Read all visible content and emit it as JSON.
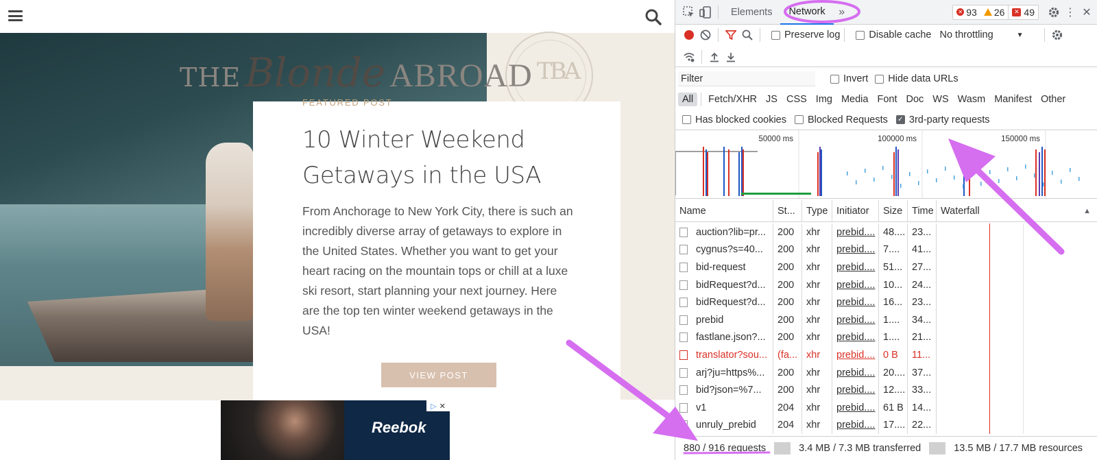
{
  "site": {
    "logo_the": "THE",
    "logo_blonde": "Blonde",
    "logo_abroad": "ABROAD",
    "stamp_mark": "TBA",
    "featured_label": "FEATURED POST",
    "post_title": "10 Winter Weekend Getaways in the USA",
    "post_excerpt": "From Anchorage to New York City, there is such an incredibly diverse array of getaways to explore in the United States. Whether you want to get your heart racing on the mountain tops or chill at a luxe ski resort, start planning your next journey. Here are the top ten winter weekend getaways in the USA!",
    "view_post_label": "VIEW POST",
    "ad_brand": "Reebok",
    "icons": {
      "menu": "hamburger-menu-icon",
      "search": "search-icon"
    }
  },
  "devtools": {
    "tabs": [
      "Elements",
      "Network"
    ],
    "active_tab": "Network",
    "more_tabs": "»",
    "errors_count": "93",
    "warnings_count": "26",
    "issues_count": "49",
    "preserve_log": "Preserve log",
    "disable_cache": "Disable cache",
    "throttling": "No throttling",
    "filter_placeholder": "Filter",
    "invert": "Invert",
    "hide_data_urls": "Hide data URLs",
    "types": [
      "All",
      "Fetch/XHR",
      "JS",
      "CSS",
      "Img",
      "Media",
      "Font",
      "Doc",
      "WS",
      "Wasm",
      "Manifest",
      "Other"
    ],
    "active_type": "All",
    "has_blocked_cookies": "Has blocked cookies",
    "blocked_requests": "Blocked Requests",
    "third_party": "3rd-party requests",
    "third_party_checked": true,
    "overview_ticks": [
      "50000 ms",
      "100000 ms",
      "150000 ms"
    ],
    "columns": [
      "Name",
      "St...",
      "Type",
      "Initiator",
      "Size",
      "Time",
      "Waterfall"
    ],
    "rows": [
      {
        "name": "auction?lib=pr...",
        "status": "200",
        "type": "xhr",
        "initiator": "prebid....",
        "size": "48....",
        "time": "23...",
        "error": false
      },
      {
        "name": "cygnus?s=40...",
        "status": "200",
        "type": "xhr",
        "initiator": "prebid....",
        "size": "7....",
        "time": "41...",
        "error": false
      },
      {
        "name": "bid-request",
        "status": "200",
        "type": "xhr",
        "initiator": "prebid....",
        "size": "51...",
        "time": "27...",
        "error": false
      },
      {
        "name": "bidRequest?d...",
        "status": "200",
        "type": "xhr",
        "initiator": "prebid....",
        "size": "10...",
        "time": "24...",
        "error": false
      },
      {
        "name": "bidRequest?d...",
        "status": "200",
        "type": "xhr",
        "initiator": "prebid....",
        "size": "16...",
        "time": "23...",
        "error": false
      },
      {
        "name": "prebid",
        "status": "200",
        "type": "xhr",
        "initiator": "prebid....",
        "size": "1....",
        "time": "34...",
        "error": false
      },
      {
        "name": "fastlane.json?...",
        "status": "200",
        "type": "xhr",
        "initiator": "prebid....",
        "size": "1....",
        "time": "21...",
        "error": false
      },
      {
        "name": "translator?sou...",
        "status": "(fa...",
        "type": "xhr",
        "initiator": "prebid....",
        "size": "0 B",
        "time": "11...",
        "error": true
      },
      {
        "name": "arj?ju=https%...",
        "status": "200",
        "type": "xhr",
        "initiator": "prebid....",
        "size": "20....",
        "time": "37...",
        "error": false
      },
      {
        "name": "bid?json=%7...",
        "status": "200",
        "type": "xhr",
        "initiator": "prebid....",
        "size": "12....",
        "time": "33...",
        "error": false
      },
      {
        "name": "v1",
        "status": "204",
        "type": "xhr",
        "initiator": "prebid....",
        "size": "61 B",
        "time": "14...",
        "error": false
      },
      {
        "name": "unruly_prebid",
        "status": "204",
        "type": "xhr",
        "initiator": "prebid....",
        "size": "17....",
        "time": "22...",
        "error": false
      }
    ],
    "status_requests": "880 / 916 requests",
    "status_transferred": "3.4 MB / 7.3 MB transferred",
    "status_resources": "13.5 MB / 17.7 MB resources",
    "accent_color": "#1a73e8",
    "annotation_color": "#d66ef0",
    "error_color": "#d93025"
  }
}
